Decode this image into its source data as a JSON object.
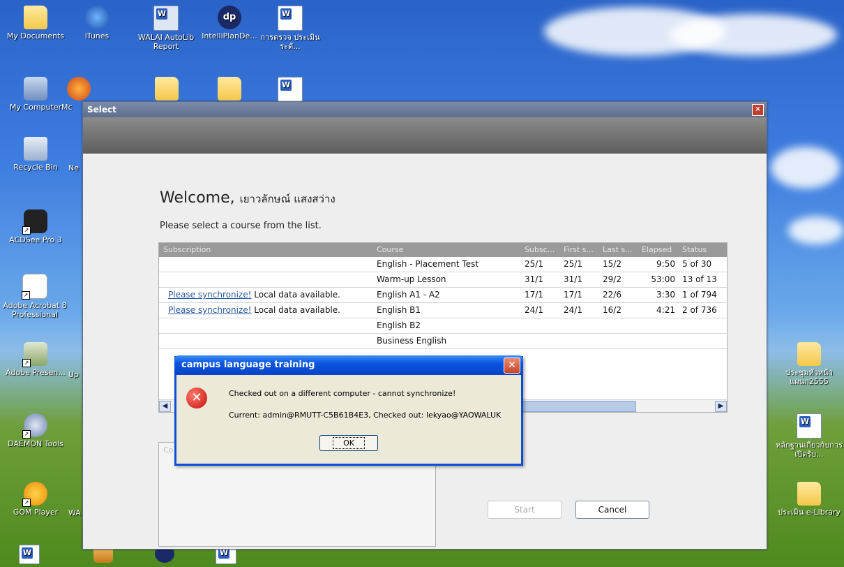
{
  "desktop": {
    "left_icons": [
      {
        "label": "My Documents"
      },
      {
        "label": "iTunes"
      },
      {
        "label": "WALAI AutoLib Report"
      },
      {
        "label": "IntelliPlanDe..."
      },
      {
        "label": "การตรวจ ประเมินระดั..."
      },
      {
        "label": "My Computer"
      },
      {
        "label": "Mc"
      },
      {
        "label": "Recycle Bin"
      },
      {
        "label": "Ne"
      },
      {
        "label": "ACDSee Pro 3"
      },
      {
        "label": "Adobe Acrobat 8 Professional"
      },
      {
        "label": "Adobe Presen..."
      },
      {
        "label": "Up"
      },
      {
        "label": "DAEMON Tools"
      },
      {
        "label": "GOM Player"
      },
      {
        "label": "WA"
      }
    ],
    "right_icons": [
      {
        "label": "ประชุมหัวหน้าแผนก2555"
      },
      {
        "label": "หลักฐานเกี่ยวกับการเปิดรับ..."
      },
      {
        "label": "ประเมิน e-Library"
      }
    ]
  },
  "window": {
    "title": "Select",
    "close_glyph": "×",
    "welcome_prefix": "Welcome,",
    "user_name": "เยาวลักษณ์ แสงสว่าง",
    "prompt": "Please select a course from the list.",
    "columns": [
      "Subscription",
      "Course",
      "Subsc...",
      "First s...",
      "Last s...",
      "Elapsed",
      "Status"
    ],
    "rows": [
      {
        "sync_link": "",
        "sync_text": "",
        "course": "English - Placement Test",
        "subsc": "25/1",
        "first": "25/1",
        "last": "15/2",
        "elapsed": "9:50",
        "status": "5 of 30"
      },
      {
        "sync_link": "",
        "sync_text": "",
        "course": "Warm-up Lesson",
        "subsc": "31/1",
        "first": "31/1",
        "last": "29/2",
        "elapsed": "53:00",
        "status": "13 of 13"
      },
      {
        "sync_link": "Please synchronize!",
        "sync_text": " Local data available.",
        "course": "English A1 - A2",
        "subsc": "17/1",
        "first": "17/1",
        "last": "22/6",
        "elapsed": "3:30",
        "status": "1 of 794"
      },
      {
        "sync_link": "Please synchronize!",
        "sync_text": " Local data available.",
        "course": "English B1",
        "subsc": "24/1",
        "first": "24/1",
        "last": "16/2",
        "elapsed": "4:21",
        "status": "2 of 736"
      },
      {
        "sync_link": "",
        "sync_text": "",
        "course": "English B2",
        "subsc": "",
        "first": "",
        "last": "",
        "elapsed": "",
        "status": ""
      },
      {
        "sync_link": "",
        "sync_text": "",
        "course": "Business English",
        "subsc": "",
        "first": "",
        "last": "",
        "elapsed": "",
        "status": ""
      }
    ],
    "panel_caption": "Co",
    "start_label": "Start",
    "cancel_label": "Cancel"
  },
  "dialog": {
    "title": "campus language training",
    "close_glyph": "✕",
    "message": "Checked out on a different computer - cannot synchronize!",
    "detail": "Current: admin@RMUTT-C5B61B4E3, Checked out: lekyao@YAOWALUK",
    "ok_label": "OK"
  },
  "colors": {
    "dialog_title": "#0644c8",
    "window_band": "#6e6e6e",
    "link": "#2c5aa0"
  }
}
